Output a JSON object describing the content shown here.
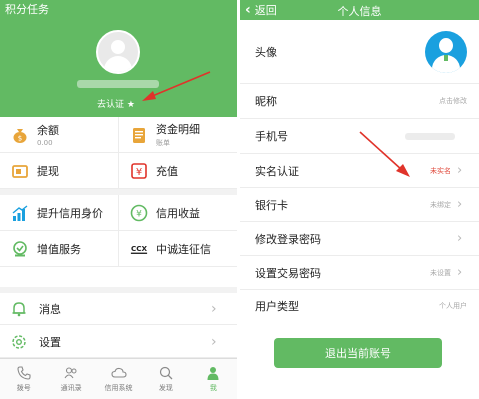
{
  "left": {
    "header_title": "积分任务",
    "auth_label": "去认证 ★",
    "grid": [
      {
        "title": "余额",
        "sub": "0.00"
      },
      {
        "title": "资金明细",
        "sub": "账单"
      },
      {
        "title": "提现",
        "sub": ""
      },
      {
        "title": "充值",
        "sub": ""
      },
      {
        "title": "提升信用身价",
        "sub": ""
      },
      {
        "title": "信用收益",
        "sub": ""
      },
      {
        "title": "增值服务",
        "sub": ""
      },
      {
        "title": "中诚连征信",
        "sub": ""
      }
    ],
    "list": [
      {
        "label": "消息"
      },
      {
        "label": "设置"
      }
    ],
    "tabs": [
      {
        "label": "拨号"
      },
      {
        "label": "通讯录"
      },
      {
        "label": "信用系统"
      },
      {
        "label": "发现"
      },
      {
        "label": "我"
      }
    ],
    "active_tab": 4,
    "logo_text": "CCX"
  },
  "right": {
    "back_label": "返回",
    "title": "个人信息",
    "rows": [
      {
        "label": "头像",
        "value": ""
      },
      {
        "label": "昵称",
        "value": "点击修改"
      },
      {
        "label": "手机号",
        "value": ""
      },
      {
        "label": "实名认证",
        "value": "未实名"
      },
      {
        "label": "银行卡",
        "value": "未绑定"
      },
      {
        "label": "修改登录密码",
        "value": ""
      },
      {
        "label": "设置交易密码",
        "value": "未设置"
      },
      {
        "label": "用户类型",
        "value": "个人用户"
      }
    ],
    "logout_label": "退出当前账号"
  },
  "colors": {
    "brand_green": "#62ba63",
    "alert_red": "#e04b3e",
    "avatar_blue": "#1aa0df"
  }
}
